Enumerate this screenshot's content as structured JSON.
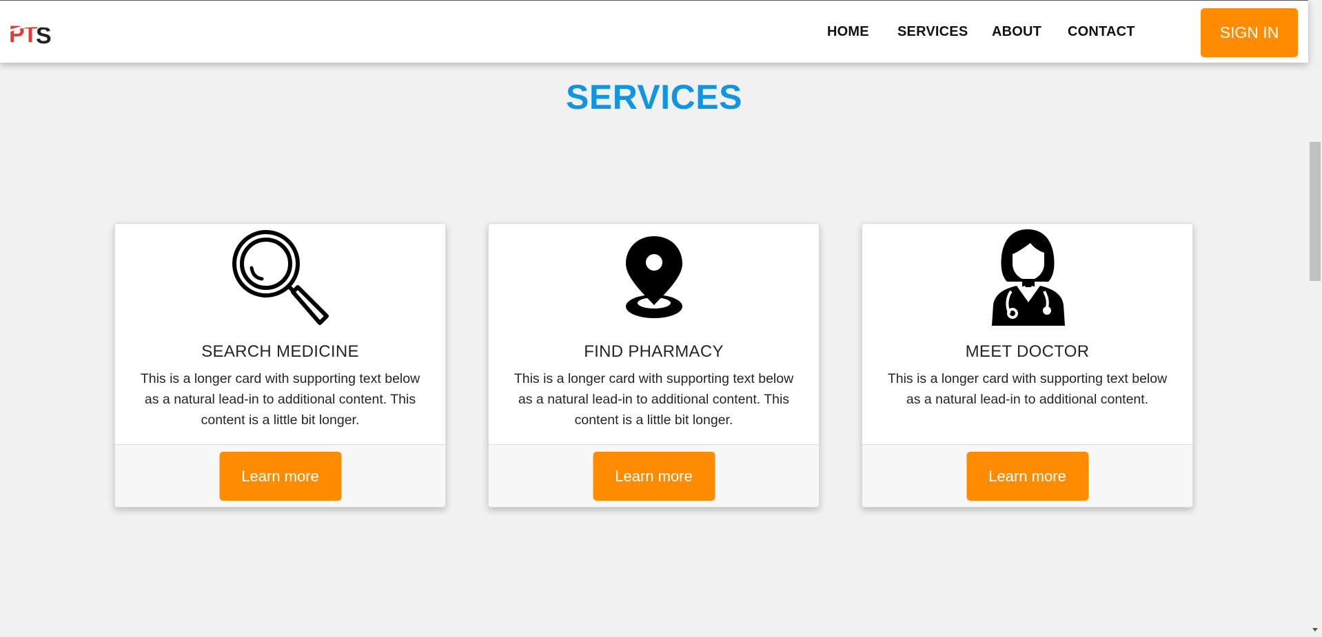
{
  "brand": {
    "logo_text": "PTS"
  },
  "nav": {
    "links": [
      "HOME",
      "SERVICES",
      "ABOUT",
      "CONTACT"
    ],
    "signin_label": "SIGN IN"
  },
  "page": {
    "title": "SERVICES"
  },
  "cards": [
    {
      "icon": "magnifying-glass-icon",
      "title": "SEARCH MEDICINE",
      "text": "This is a longer card with supporting text below as a natural lead-in to additional content. This content is a little bit longer.",
      "button_label": "Learn more"
    },
    {
      "icon": "map-pin-icon",
      "title": "FIND PHARMACY",
      "text": "This is a longer card with supporting text below as a natural lead-in to additional content. This content is a little bit longer.",
      "button_label": "Learn more"
    },
    {
      "icon": "doctor-icon",
      "title": "MEET DOCTOR",
      "text": "This is a longer card with supporting text below as a natural lead-in to additional content.",
      "button_label": "Learn more"
    }
  ],
  "colors": {
    "accent": "#ff8c00",
    "title": "#0e96e4",
    "background": "#f1f1f1",
    "logo_red": "#e53935"
  }
}
